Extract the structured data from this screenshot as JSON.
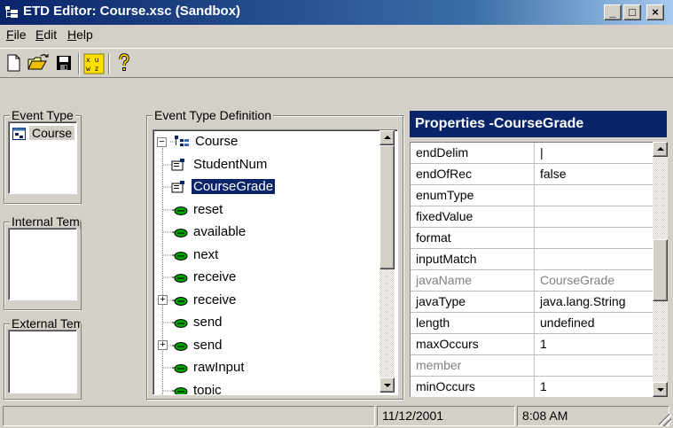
{
  "window": {
    "title": "ETD Editor: Course.xsc (Sandbox)",
    "minimize_glyph": "_",
    "maximize_glyph": "□",
    "close_glyph": "×"
  },
  "menu": {
    "items": [
      {
        "hotkey": "F",
        "rest": "ile"
      },
      {
        "hotkey": "E",
        "rest": "dit"
      },
      {
        "hotkey": "H",
        "rest": "elp"
      }
    ]
  },
  "toolbar": {
    "icons": [
      "new-file-icon",
      "open-folder-icon",
      "save-disk-icon",
      "grid-layout-icon",
      "help-question-icon"
    ]
  },
  "event_type": {
    "label": "Event Type",
    "items": [
      "Course"
    ]
  },
  "internal_templates": {
    "label": "Internal Templates"
  },
  "external_templates": {
    "label": "External Templates"
  },
  "definition": {
    "label": "Event Type Definition",
    "root": "Course",
    "nodes": [
      {
        "label": "StudentNum",
        "kind": "field",
        "selected": false,
        "expandable": false
      },
      {
        "label": "CourseGrade",
        "kind": "field",
        "selected": true,
        "expandable": false
      },
      {
        "label": "reset",
        "kind": "method",
        "selected": false,
        "expandable": false
      },
      {
        "label": "available",
        "kind": "method",
        "selected": false,
        "expandable": false
      },
      {
        "label": "next",
        "kind": "method",
        "selected": false,
        "expandable": false
      },
      {
        "label": "receive",
        "kind": "method",
        "selected": false,
        "expandable": false
      },
      {
        "label": "receive",
        "kind": "method",
        "selected": false,
        "expandable": true
      },
      {
        "label": "send",
        "kind": "method",
        "selected": false,
        "expandable": false
      },
      {
        "label": "send",
        "kind": "method",
        "selected": false,
        "expandable": true
      },
      {
        "label": "rawInput",
        "kind": "method",
        "selected": false,
        "expandable": false
      },
      {
        "label": "topic",
        "kind": "method",
        "selected": false,
        "expandable": false
      }
    ]
  },
  "properties": {
    "title": "Properties -CourseGrade",
    "rows": [
      {
        "name": "endDelim",
        "value": "|",
        "disabled": false
      },
      {
        "name": "endOfRec",
        "value": "false",
        "disabled": false
      },
      {
        "name": "enumType",
        "value": "",
        "disabled": false
      },
      {
        "name": "fixedValue",
        "value": "",
        "disabled": false
      },
      {
        "name": "format",
        "value": "",
        "disabled": false
      },
      {
        "name": "inputMatch",
        "value": "",
        "disabled": false
      },
      {
        "name": "javaName",
        "value": "CourseGrade",
        "disabled": true
      },
      {
        "name": "javaType",
        "value": "java.lang.String",
        "disabled": false
      },
      {
        "name": "length",
        "value": "undefined",
        "disabled": false
      },
      {
        "name": "maxOccurs",
        "value": "1",
        "disabled": false
      },
      {
        "name": "member",
        "value": "",
        "disabled": true
      },
      {
        "name": "minOccurs",
        "value": "1",
        "disabled": false
      }
    ]
  },
  "status": {
    "message": "",
    "date": "11/12/2001",
    "time": "8:08 AM"
  }
}
